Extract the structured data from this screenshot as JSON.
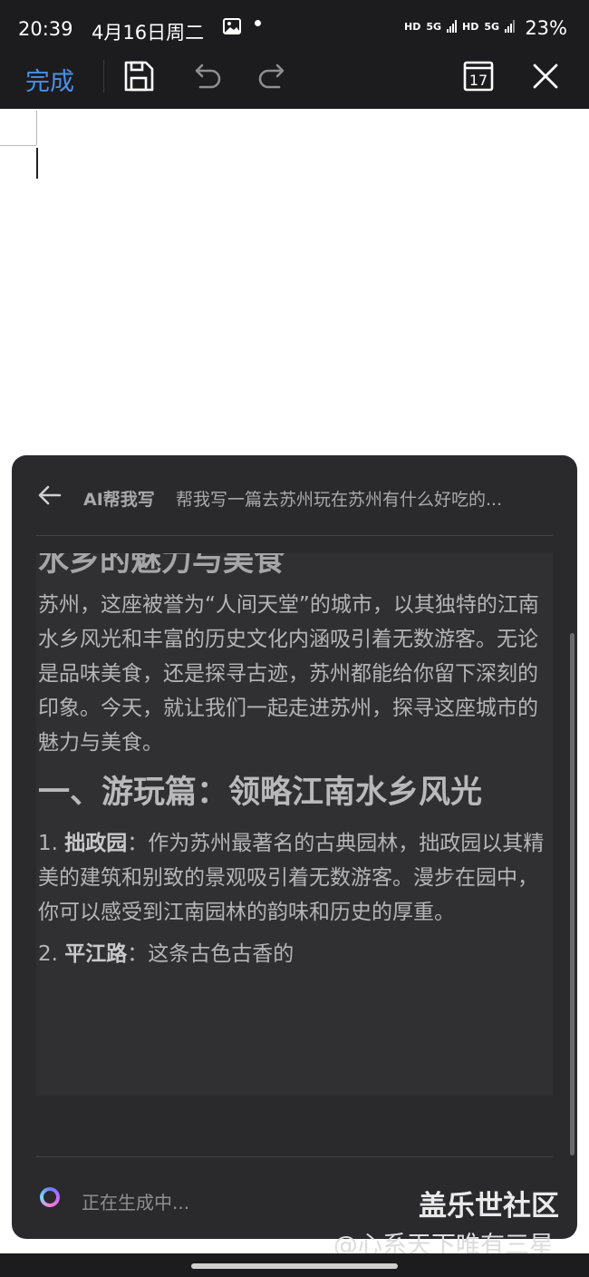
{
  "status_bar": {
    "time": "20:39",
    "date": "4月16日周二",
    "network_1": "HD",
    "network_2": "5G",
    "network_3": "HD",
    "network_4": "5G",
    "battery": "23%"
  },
  "toolbar": {
    "done_label": "完成",
    "icons": [
      "save-icon",
      "undo-icon",
      "redo-icon",
      "calendar-icon",
      "close-icon"
    ],
    "calendar_day": "17"
  },
  "ai_panel": {
    "title": "AI帮我写",
    "prompt": "帮我写一篇去苏州玩在苏州有什么好吃的...",
    "content": {
      "partial_heading": "水乡的魅力与美食",
      "intro": "苏州，这座被誉为“人间天堂”的城市，以其独特的江南水乡风光和丰富的历史文化内涵吸引着无数游客。无论是品味美食，还是探寻古迹，苏州都能给你留下深刻的印象。今天，就让我们一起走进苏州，探寻这座城市的魅力与美食。",
      "section_heading": "一、游玩篇：领略江南水乡风光",
      "item1_number": "1.",
      "item1_title": "拙政园",
      "item1_text": "：作为苏州最著名的古典园林，拙政园以其精美的建筑和别致的景观吸引着无数游客。漫步在园中，你可以感受到江南园林的韵味和历史的厚重。",
      "item2_number": "2.",
      "item2_title": "平江路",
      "item2_text": "：这条古色古香的"
    },
    "generating_text": "正在生成中..."
  },
  "watermark": {
    "line1": "盖乐世社区",
    "line2": "@心系天下唯有三星"
  },
  "colors": {
    "accent": "#4a8fe7",
    "panel_bg": "#2a2a2c",
    "bar_bg": "#1c1c1e"
  }
}
